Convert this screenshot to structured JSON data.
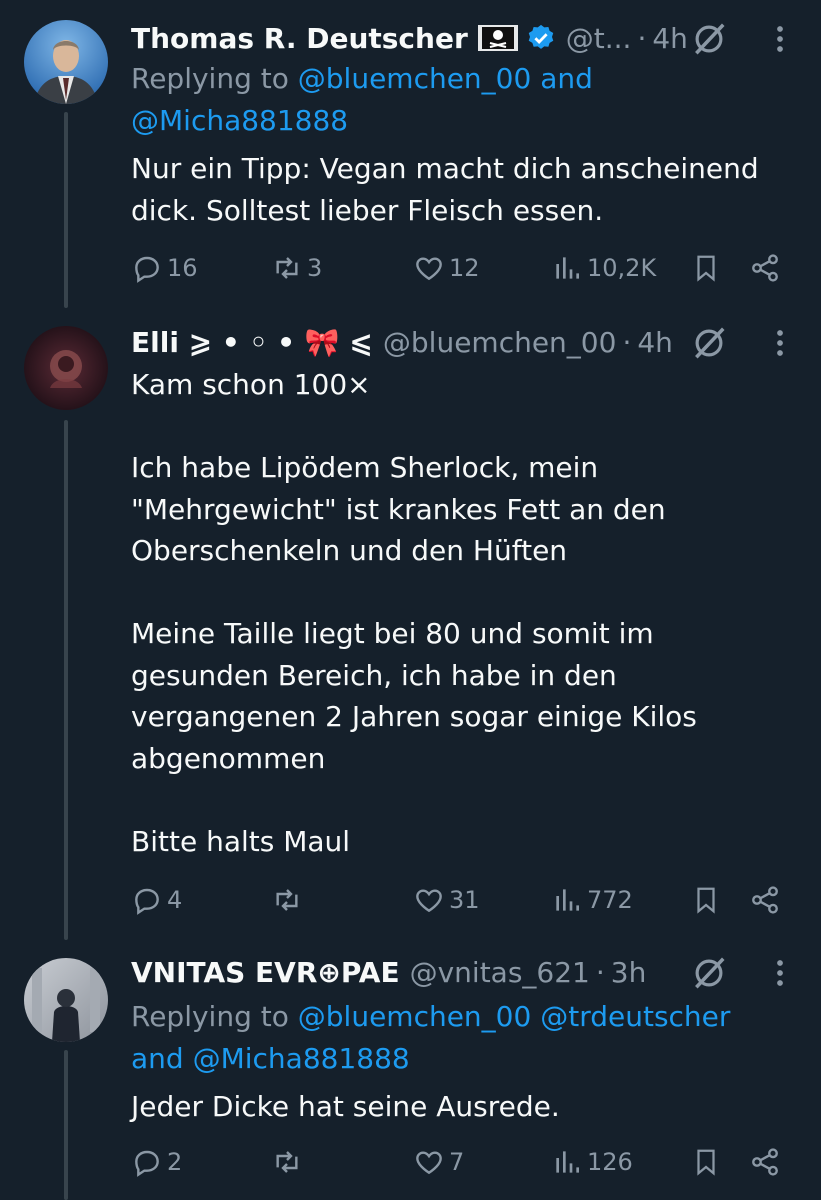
{
  "tweets": [
    {
      "name": "Thomas R. Deutscher",
      "handle": "@t...",
      "time": "4h",
      "reply_prefix": "Replying to ",
      "reply_mention1": "@bluemchen_00",
      "reply_and": " and",
      "reply_mention2": "@Micha881888",
      "text": "Nur ein Tipp: Vegan macht dich anscheinend dick. Solltest lieber Fleisch essen.",
      "replies": "16",
      "retweets": "3",
      "likes": "12",
      "views": "10,2K"
    },
    {
      "name": "Elli ⩾ • ◦ • 🎀 ⩽",
      "handle": "@bluemchen_00",
      "time": "4h",
      "text": "Kam schon 100×\n\nIch habe Lipödem Sherlock, mein \"Mehrgewicht\" ist krankes Fett an den Oberschenkeln und den Hüften\n\nMeine Taille liegt bei 80 und somit im gesunden Bereich, ich habe in den vergangenen 2 Jahren sogar einige Kilos abgenommen\n\nBitte halts Maul",
      "replies": "4",
      "retweets": "",
      "likes": "31",
      "views": "772"
    },
    {
      "name": "VNITAS EVR⊕PAE",
      "handle": "@vnitas_621",
      "time": "3h",
      "reply_prefix": "Replying to ",
      "reply_mention1": "@bluemchen_00",
      "reply_mention2": "@trdeutscher",
      "reply_and": "and ",
      "reply_mention3": "@Micha881888",
      "text": "Jeder Dicke hat seine Ausrede.",
      "replies": "2",
      "retweets": "",
      "likes": "7",
      "views": "126"
    }
  ],
  "colors": {
    "background": "#15202b",
    "muted": "#8b98a5",
    "link": "#1d9bf0",
    "text": "#f7f9f9"
  },
  "icons": [
    "reply-icon",
    "retweet-icon",
    "like-icon",
    "views-icon",
    "bookmark-icon",
    "share-icon",
    "grok-icon",
    "more-icon",
    "verified-icon",
    "pirate-flag-icon"
  ]
}
